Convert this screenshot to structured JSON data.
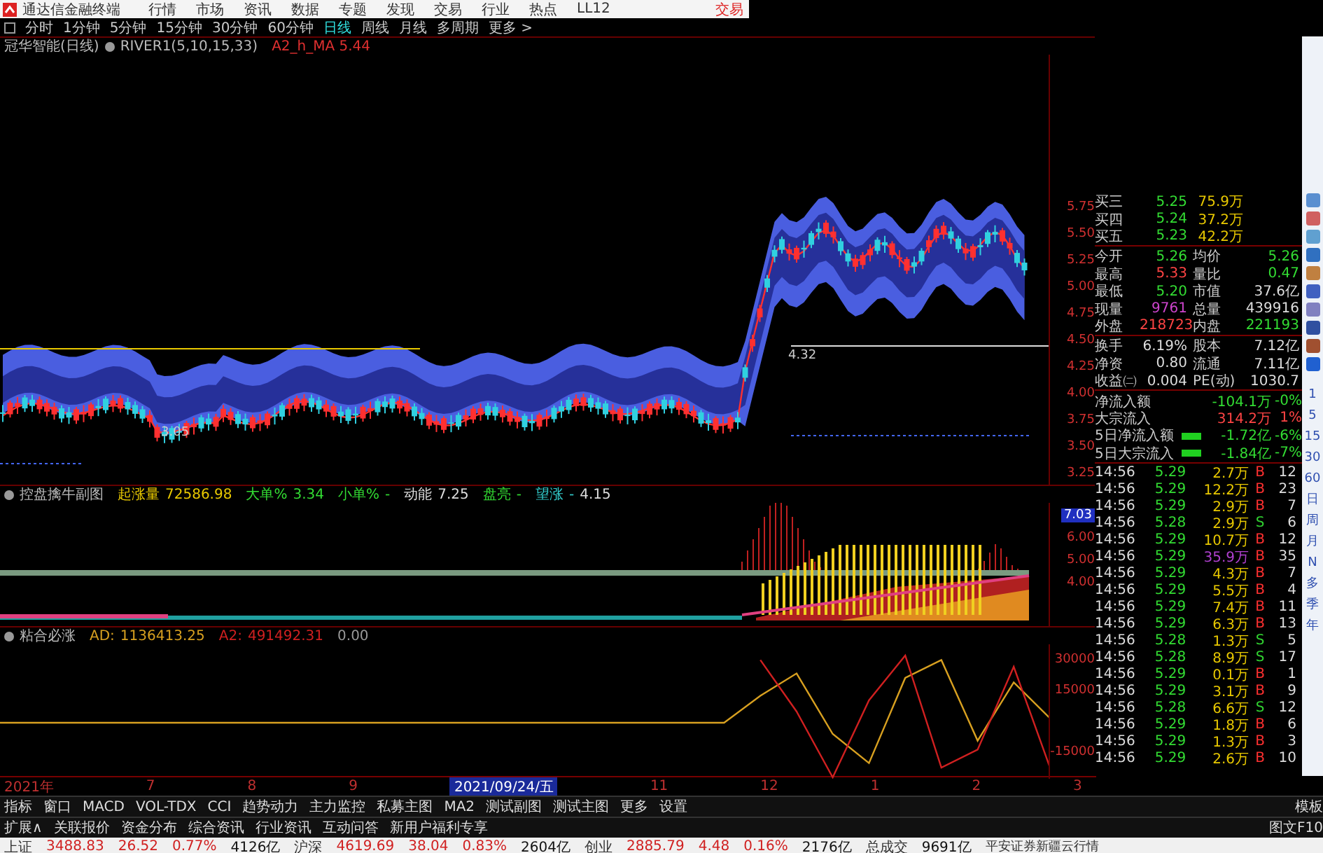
{
  "app": {
    "title": "通达信金融终端",
    "menu": [
      "行情",
      "市场",
      "资讯",
      "数据",
      "专题",
      "发现",
      "交易",
      "行业",
      "热点",
      "LL12"
    ],
    "trade_button": "交易"
  },
  "periods": [
    {
      "label": "分时",
      "selected": false
    },
    {
      "label": "1分钟",
      "selected": false
    },
    {
      "label": "5分钟",
      "selected": false
    },
    {
      "label": "15分钟",
      "selected": false
    },
    {
      "label": "30分钟",
      "selected": false
    },
    {
      "label": "60分钟",
      "selected": false
    },
    {
      "label": "日线",
      "selected": true
    },
    {
      "label": "周线",
      "selected": false
    },
    {
      "label": "月线",
      "selected": false
    },
    {
      "label": "多周期",
      "selected": false
    },
    {
      "label": "更多 >",
      "selected": false
    }
  ],
  "main_chart": {
    "title": "冠华智能(日线)",
    "indicator": "RIVER1(5,10,15,33)",
    "reading": "A2_h_MA 5.44",
    "price_axis": [
      "5.75",
      "5.50",
      "5.25",
      "5.00",
      "4.75",
      "4.50",
      "4.25",
      "4.00",
      "3.75",
      "3.50",
      "3.25"
    ],
    "low_label": "3.05",
    "line_label": "4.32"
  },
  "sub_chart_1": {
    "title": "控盘擒牛副图",
    "fields": [
      {
        "label": "起涨量",
        "value": "72586.98"
      },
      {
        "label": "大单%",
        "value": "3.34"
      },
      {
        "label": "小单%",
        "value": "-"
      },
      {
        "label": "动能",
        "value": "7.25"
      },
      {
        "label": "盘亮",
        "value": "-"
      },
      {
        "label": "望涨",
        "value": "-"
      },
      {
        "value": "4.15"
      }
    ],
    "axis": [
      "7.03",
      "6.00",
      "5.00",
      "4.00"
    ]
  },
  "sub_chart_2": {
    "title": "粘合必涨",
    "readings": [
      "1136413.25",
      "491492.31"
    ],
    "extra_value": "0.00",
    "chart_data": {
      "type": "line",
      "yticks": [
        30000,
        15000,
        -15000
      ],
      "ylim": [
        -25000,
        35000
      ],
      "series": [
        {
          "name": "AD:",
          "color": "#d8a020",
          "values": [
            0,
            0,
            0,
            0,
            0,
            0,
            0,
            0,
            0,
            0,
            0,
            0,
            0,
            0,
            0,
            0,
            0,
            0,
            0,
            0,
            0,
            12000,
            22000,
            -5000,
            -18000,
            20000,
            28000,
            -8000,
            18000,
            2000
          ]
        },
        {
          "name": "A2:",
          "color": "#d02020",
          "values": [
            null,
            null,
            null,
            null,
            null,
            null,
            null,
            null,
            null,
            null,
            null,
            null,
            null,
            null,
            null,
            null,
            null,
            null,
            null,
            null,
            null,
            28000,
            5000,
            -25000,
            10000,
            30000,
            -20000,
            -12000,
            25000,
            -20000
          ]
        }
      ]
    }
  },
  "date_axis": [
    {
      "label": "2021年",
      "cursor": false
    },
    {
      "label": "7",
      "cursor": false
    },
    {
      "label": "8",
      "cursor": false
    },
    {
      "label": "9",
      "cursor": false
    },
    {
      "label": "2021/09/24/五",
      "cursor": true
    },
    {
      "label": "11",
      "cursor": false
    },
    {
      "label": "12",
      "cursor": false
    },
    {
      "label": "1",
      "cursor": false
    },
    {
      "label": "2",
      "cursor": false
    },
    {
      "label": "3",
      "cursor": false
    }
  ],
  "indicator_tabs": [
    "指标",
    "窗口",
    "MACD",
    "VOL-TDX",
    "CCI",
    "趋势动力",
    "主力监控",
    "私募主图",
    "MA2",
    "测试副图",
    "测试主图",
    "更多",
    "设置"
  ],
  "template_button": "模板",
  "extension_tabs": [
    "扩展∧",
    "关联报价",
    "资金分布",
    "综合资讯",
    "行业资讯",
    "互动问答",
    "新用户福利专享"
  ],
  "f10_button": "图文F10",
  "quote": {
    "depth": [
      {
        "label": "买三",
        "price": "5.25",
        "volume": "75.9万"
      },
      {
        "label": "买四",
        "price": "5.24",
        "volume": "37.2万"
      },
      {
        "label": "买五",
        "price": "5.23",
        "volume": "42.2万"
      }
    ],
    "stats": [
      {
        "cells": [
          {
            "label": "今开",
            "value": "5.26",
            "color": "#33dd33"
          },
          {
            "label": "均价",
            "value": "5.26",
            "color": "#33dd33"
          }
        ]
      },
      {
        "cells": [
          {
            "label": "最高",
            "value": "5.33",
            "color": "#ff4444"
          },
          {
            "label": "量比",
            "value": "0.47",
            "color": "#33dd33"
          }
        ]
      },
      {
        "cells": [
          {
            "label": "最低",
            "value": "5.20",
            "color": "#33dd33"
          },
          {
            "label": "市值",
            "value": "37.6亿",
            "color": "#dddddd"
          }
        ]
      },
      {
        "cells": [
          {
            "label": "现量",
            "value": "9761",
            "color": "#cc44cc"
          },
          {
            "label": "总量",
            "value": "439916",
            "color": "#dddddd"
          }
        ]
      },
      {
        "cells": [
          {
            "label": "外盘",
            "value": "218723",
            "color": "#ff4444"
          },
          {
            "label": "内盘",
            "value": "221193",
            "color": "#33dd33"
          }
        ]
      },
      {
        "cells": [
          {
            "label": "换手",
            "value": "6.19%",
            "color": "#dddddd"
          },
          {
            "label": "股本",
            "value": "7.12亿",
            "color": "#dddddd"
          }
        ]
      },
      {
        "cells": [
          {
            "label": "净资",
            "value": "0.80",
            "color": "#dddddd"
          },
          {
            "label": "流通",
            "value": "7.11亿",
            "color": "#dddddd"
          }
        ]
      },
      {
        "cells": [
          {
            "label": "收益㈡",
            "value": "0.004",
            "color": "#dddddd"
          },
          {
            "label": "PE(动)",
            "value": "1030.7",
            "color": "#dddddd"
          }
        ]
      }
    ],
    "flows": [
      {
        "label": "净流入额",
        "value": "-104.1万",
        "pct": "-0%",
        "color": "#33dd33",
        "bar": false
      },
      {
        "label": "大宗流入",
        "value": "314.2万",
        "pct": "1%",
        "color": "#ff4444",
        "bar": false
      },
      {
        "label": "5日净流入额",
        "value": "-1.72亿",
        "pct": "-6%",
        "color": "#33dd33",
        "bar": true
      },
      {
        "label": "5日大宗流入",
        "value": "-1.84亿",
        "pct": "-7%",
        "color": "#33dd33",
        "bar": true
      }
    ]
  },
  "ticks": [
    {
      "time": "14:56",
      "price": "5.29",
      "volume": "2.7万",
      "side": "B",
      "buy": true,
      "large": false,
      "count": "12"
    },
    {
      "time": "14:56",
      "price": "5.29",
      "volume": "12.2万",
      "side": "B",
      "buy": true,
      "large": false,
      "count": "23"
    },
    {
      "time": "14:56",
      "price": "5.29",
      "volume": "2.9万",
      "side": "B",
      "buy": true,
      "large": false,
      "count": "7"
    },
    {
      "time": "14:56",
      "price": "5.28",
      "volume": "2.9万",
      "side": "S",
      "buy": false,
      "large": false,
      "count": "6"
    },
    {
      "time": "14:56",
      "price": "5.29",
      "volume": "10.7万",
      "side": "B",
      "buy": true,
      "large": false,
      "count": "12"
    },
    {
      "time": "14:56",
      "price": "5.29",
      "volume": "35.9万",
      "side": "B",
      "buy": true,
      "large": true,
      "count": "35"
    },
    {
      "time": "14:56",
      "price": "5.29",
      "volume": "4.3万",
      "side": "B",
      "buy": true,
      "large": false,
      "count": "7"
    },
    {
      "time": "14:56",
      "price": "5.29",
      "volume": "5.5万",
      "side": "B",
      "buy": true,
      "large": false,
      "count": "4"
    },
    {
      "time": "14:56",
      "price": "5.29",
      "volume": "7.4万",
      "side": "B",
      "buy": true,
      "large": false,
      "count": "11"
    },
    {
      "time": "14:56",
      "price": "5.29",
      "volume": "6.3万",
      "side": "B",
      "buy": true,
      "large": false,
      "count": "13"
    },
    {
      "time": "14:56",
      "price": "5.28",
      "volume": "1.3万",
      "side": "S",
      "buy": false,
      "large": false,
      "count": "5"
    },
    {
      "time": "14:56",
      "price": "5.28",
      "volume": "8.9万",
      "side": "S",
      "buy": false,
      "large": false,
      "count": "17"
    },
    {
      "time": "14:56",
      "price": "5.29",
      "volume": "0.1万",
      "side": "B",
      "buy": true,
      "large": false,
      "count": "1"
    },
    {
      "time": "14:56",
      "price": "5.29",
      "volume": "3.1万",
      "side": "B",
      "buy": true,
      "large": false,
      "count": "9"
    },
    {
      "time": "14:56",
      "price": "5.28",
      "volume": "6.6万",
      "side": "S",
      "buy": false,
      "large": false,
      "count": "12"
    },
    {
      "time": "14:56",
      "price": "5.29",
      "volume": "1.8万",
      "side": "B",
      "buy": true,
      "large": false,
      "count": "6"
    },
    {
      "time": "14:56",
      "price": "5.29",
      "volume": "1.3万",
      "side": "B",
      "buy": true,
      "large": false,
      "count": "3"
    },
    {
      "time": "14:56",
      "price": "5.29",
      "volume": "2.6万",
      "side": "B",
      "buy": true,
      "large": false,
      "count": "10"
    }
  ],
  "side_periods": [
    "1",
    "5",
    "15",
    "30",
    "60",
    "日",
    "周",
    "月",
    "N",
    "多",
    "季",
    "年"
  ],
  "status_bar": {
    "indices": [
      {
        "label": "上证",
        "value": "3488.83",
        "change": "26.52",
        "pct": "0.77%",
        "amount": "4126亿"
      },
      {
        "label": "沪深",
        "value": "4619.69",
        "change": "38.04",
        "pct": "0.83%",
        "amount": "2604亿"
      },
      {
        "label": "创业",
        "value": "2885.79",
        "change": "4.48",
        "pct": "0.16%",
        "amount": "2176亿"
      }
    ],
    "total_label": "总成交",
    "total_value": "9691亿",
    "broker": "平安证券新疆云行情"
  }
}
